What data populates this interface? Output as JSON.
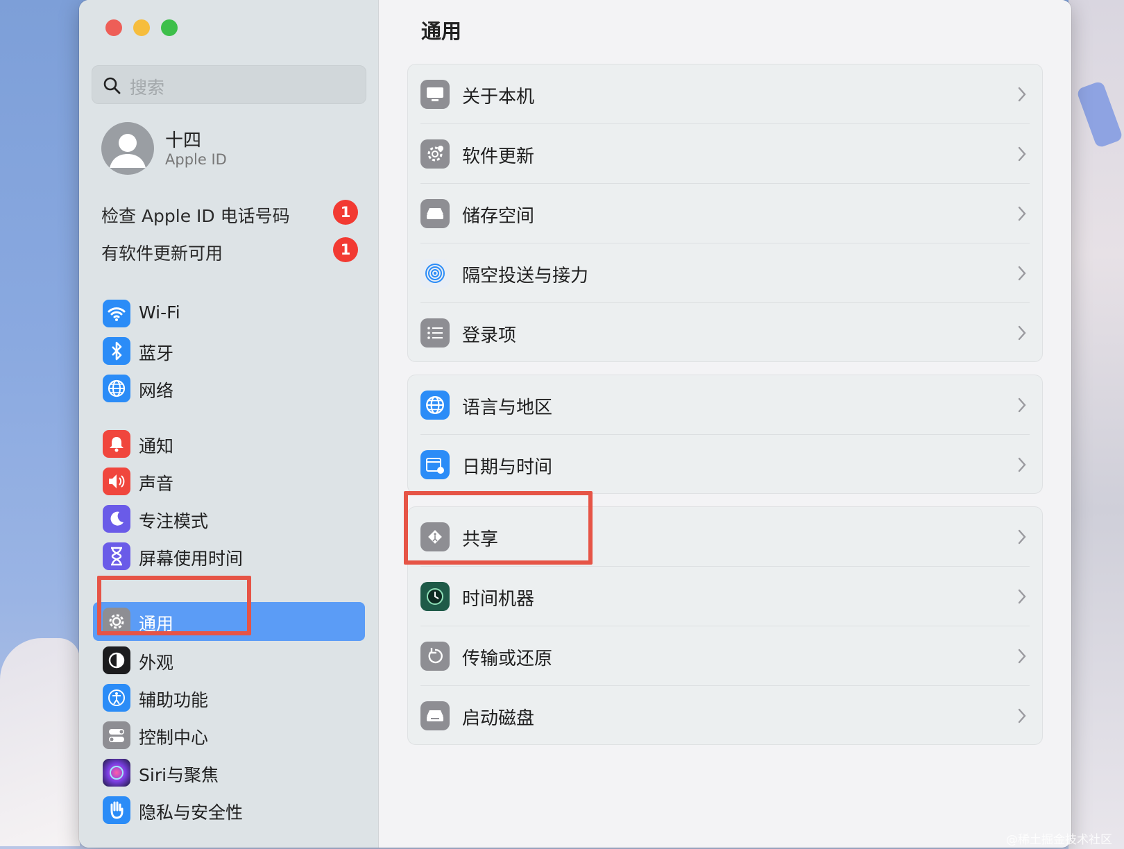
{
  "search": {
    "placeholder": "搜索"
  },
  "profile": {
    "name": "十四",
    "subtitle": "Apple ID"
  },
  "alerts": [
    {
      "label": "检查 Apple ID 电话号码",
      "count": "1"
    },
    {
      "label": "有软件更新可用",
      "count": "1"
    }
  ],
  "sidebar": {
    "items": [
      {
        "label": "Wi-Fi",
        "icon": "wifi-icon",
        "color": "#2b8cf7"
      },
      {
        "label": "蓝牙",
        "icon": "bluetooth-icon",
        "color": "#2b8cf7"
      },
      {
        "label": "网络",
        "icon": "globe-icon",
        "color": "#2b8cf7"
      },
      {
        "label": "通知",
        "icon": "bell-icon",
        "color": "#f0463d"
      },
      {
        "label": "声音",
        "icon": "speaker-icon",
        "color": "#f0463d"
      },
      {
        "label": "专注模式",
        "icon": "moon-icon",
        "color": "#6a5be8"
      },
      {
        "label": "屏幕使用时间",
        "icon": "hourglass-icon",
        "color": "#6a5be8"
      },
      {
        "label": "通用",
        "icon": "gear-icon",
        "color": "#8e8e93",
        "selected": true
      },
      {
        "label": "外观",
        "icon": "appearance-icon",
        "color": "#1c1c1e"
      },
      {
        "label": "辅助功能",
        "icon": "accessibility-icon",
        "color": "#2b8cf7"
      },
      {
        "label": "控制中心",
        "icon": "control-center-icon",
        "color": "#8e8e93"
      },
      {
        "label": "Siri与聚焦",
        "icon": "siri-icon",
        "color": "#7b3fe4"
      },
      {
        "label": "隐私与安全性",
        "icon": "hand-icon",
        "color": "#2b8cf7"
      }
    ]
  },
  "main": {
    "title": "通用",
    "groups": [
      [
        {
          "label": "关于本机",
          "icon": "display-icon"
        },
        {
          "label": "软件更新",
          "icon": "gear-badge-icon"
        },
        {
          "label": "储存空间",
          "icon": "drive-icon"
        },
        {
          "label": "隔空投送与接力",
          "icon": "airdrop-icon"
        },
        {
          "label": "登录项",
          "icon": "list-icon"
        }
      ],
      [
        {
          "label": "语言与地区",
          "icon": "globe-icon"
        },
        {
          "label": "日期与时间",
          "icon": "calendar-clock-icon"
        }
      ],
      [
        {
          "label": "共享",
          "icon": "sharing-icon"
        },
        {
          "label": "时间机器",
          "icon": "time-machine-icon"
        },
        {
          "label": "传输或还原",
          "icon": "restore-icon"
        },
        {
          "label": "启动磁盘",
          "icon": "startup-disk-icon"
        }
      ]
    ]
  },
  "watermark": "@稀土掘金技术社区"
}
